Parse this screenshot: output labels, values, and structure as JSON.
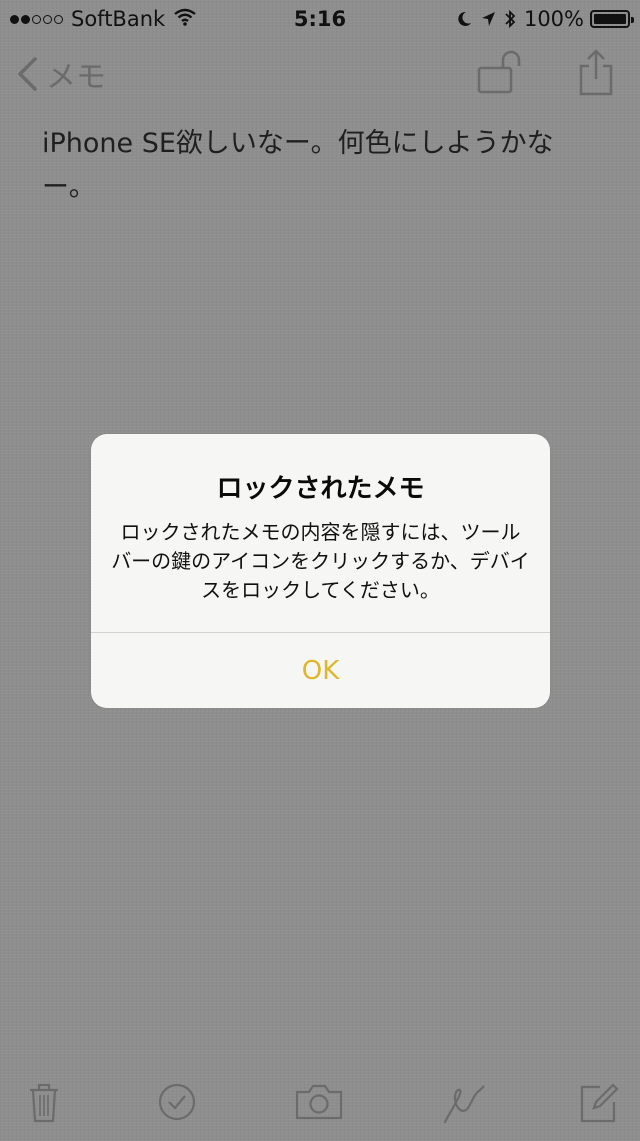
{
  "status_bar": {
    "signal_strength": 2,
    "signal_total": 5,
    "carrier": "SoftBank",
    "time": "5:16",
    "battery": "100%",
    "icons": [
      "wifi-icon",
      "moon-icon",
      "location-arrow-icon",
      "bluetooth-icon"
    ]
  },
  "nav": {
    "back_label": "メモ",
    "back_icon": "chevron-left-icon",
    "lock_icon": "unlocked-padlock-icon",
    "share_icon": "share-icon"
  },
  "note": {
    "text": "iPhone SE欲しいなー。何色にしようかなー。"
  },
  "alert": {
    "title": "ロックされたメモ",
    "message": "ロックされたメモの内容を隠すには、ツールバーの鍵のアイコンをクリックするか、デバイスをロックしてください。",
    "ok_label": "OK",
    "accent_color": "#e0b62a"
  },
  "toolbar": {
    "icons": [
      "trash-icon",
      "checklist-icon",
      "camera-icon",
      "sketch-icon",
      "compose-icon"
    ]
  }
}
